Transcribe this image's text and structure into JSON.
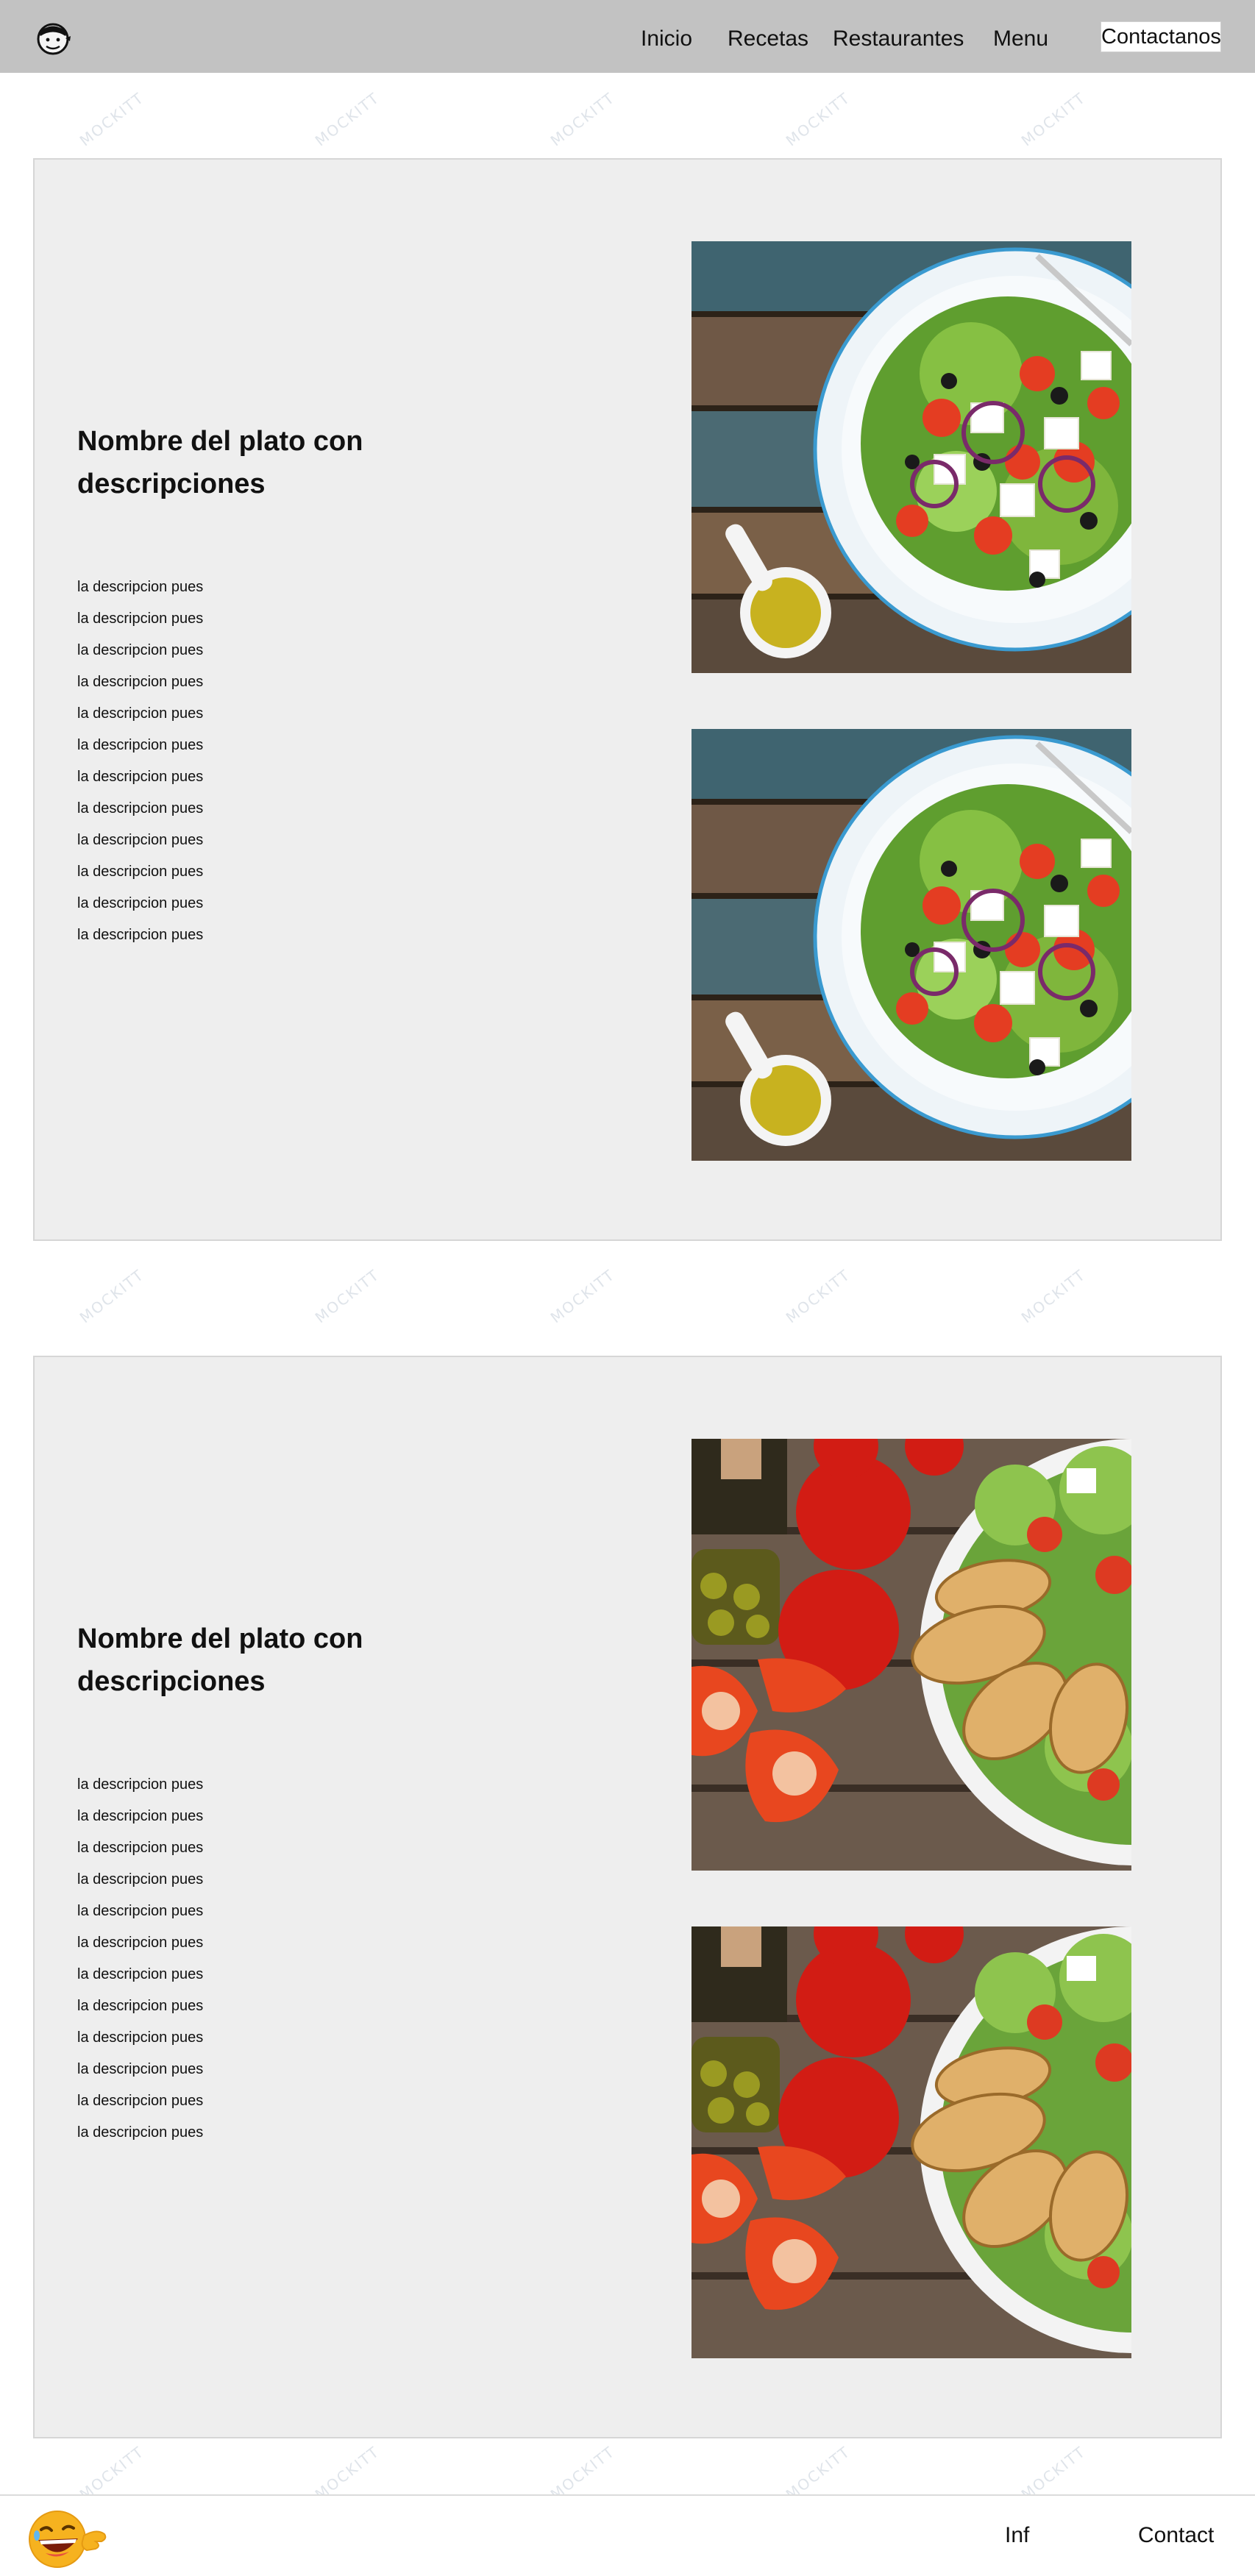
{
  "header": {
    "logo": "chef-logo-icon",
    "nav": {
      "inicio": "Inicio",
      "recetas": "Recetas",
      "restaurantes": "Restaurantes",
      "menu": "Menu"
    },
    "contact_label": "Contactanos"
  },
  "watermark": "MOCKITT",
  "dishes": [
    {
      "title": "Nombre del plato con descripciones",
      "descriptions": [
        "la descripcion pues",
        "la descripcion pues",
        "la descripcion pues",
        "la descripcion pues",
        "la descripcion pues",
        "la descripcion pues",
        "la descripcion pues",
        "la descripcion pues",
        "la descripcion pues",
        "la descripcion pues",
        "la descripcion pues",
        "la descripcion pues"
      ],
      "images": [
        "greek-salad-photo",
        "greek-salad-photo"
      ]
    },
    {
      "title": "Nombre del plato con descripciones",
      "descriptions": [
        "la descripcion pues",
        "la descripcion pues",
        "la descripcion pues",
        "la descripcion pues",
        "la descripcion pues",
        "la descripcion pues",
        "la descripcion pues",
        "la descripcion pues",
        "la descripcion pues",
        "la descripcion pues",
        "la descripcion pues",
        "la descripcion pues"
      ],
      "images": [
        "tomato-bruschetta-photo",
        "tomato-bruschetta-photo"
      ]
    }
  ],
  "footer": {
    "emoji": "laughing-emoji-icon",
    "inf_label": "Inf",
    "contact_label": "Contact"
  },
  "colors": {
    "header_bg": "#c2c2c2",
    "card_bg": "#eeeeee",
    "page_bg": "#ffffff"
  }
}
